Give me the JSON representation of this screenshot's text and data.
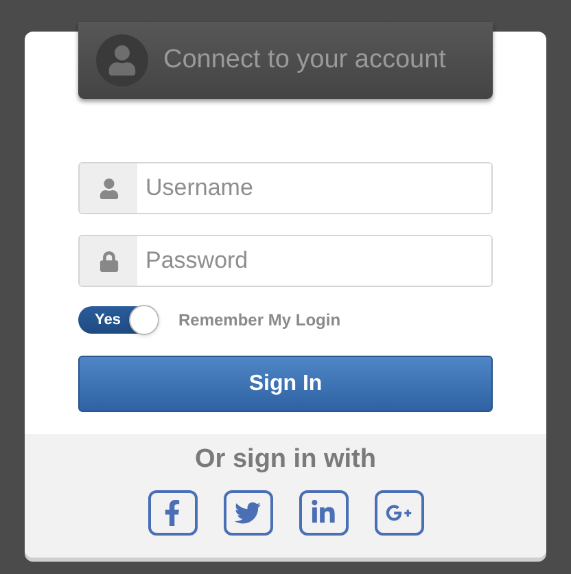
{
  "header": {
    "title": "Connect to your account"
  },
  "fields": [
    {
      "kind": "user",
      "placeholder": "Username"
    },
    {
      "kind": "lock",
      "placeholder": "Password"
    }
  ],
  "remember": {
    "label": "Remember My Login",
    "switch_text": "Yes",
    "on": true
  },
  "submit": {
    "label": "Sign In"
  },
  "social": {
    "title": "Or sign in with"
  }
}
